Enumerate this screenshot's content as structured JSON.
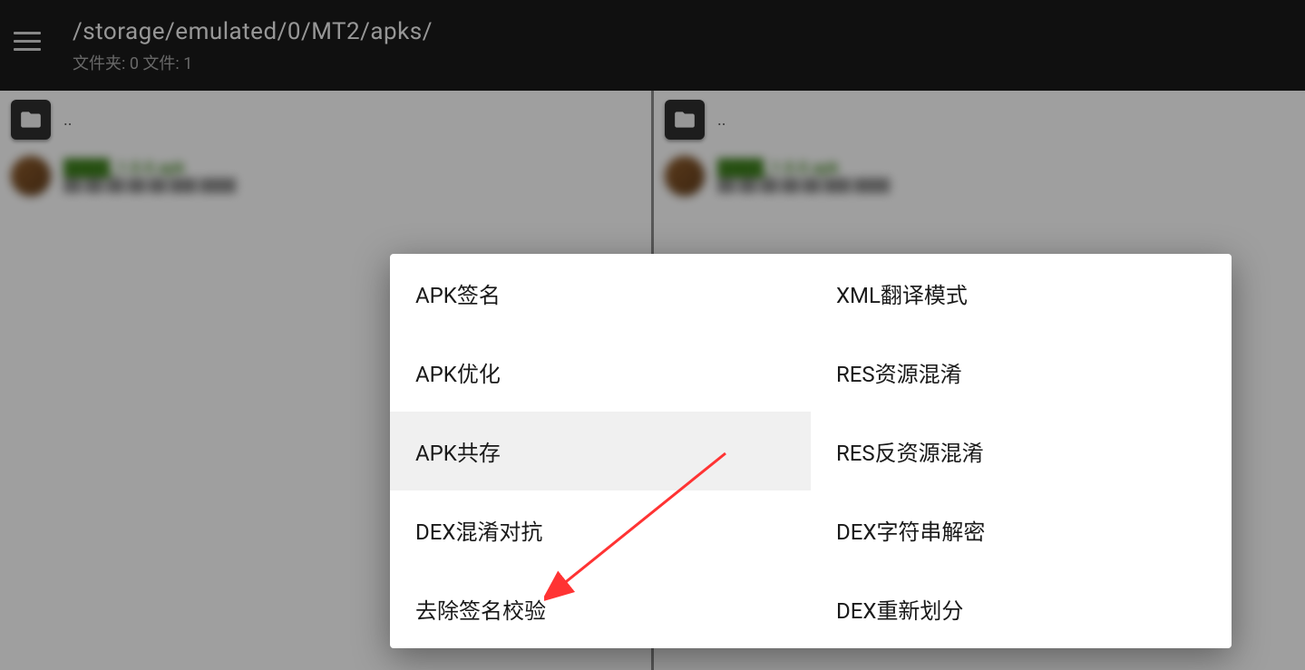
{
  "header": {
    "path": "/storage/emulated/0/MT2/apks/",
    "subtitle": "文件夹: 0  文件: 1"
  },
  "panes": {
    "parent_label": "..",
    "apk_name_blur": "████_1.0.0.apk",
    "apk_meta_blur": "██-██-██ ██:██  ███ ████"
  },
  "dialog": {
    "left_column": [
      "APK签名",
      "APK优化",
      "APK共存",
      "DEX混淆对抗",
      "去除签名校验"
    ],
    "right_column": [
      "XML翻译模式",
      "RES资源混淆",
      "RES反资源混淆",
      "DEX字符串解密",
      "DEX重新划分"
    ],
    "highlighted_index": 2
  }
}
